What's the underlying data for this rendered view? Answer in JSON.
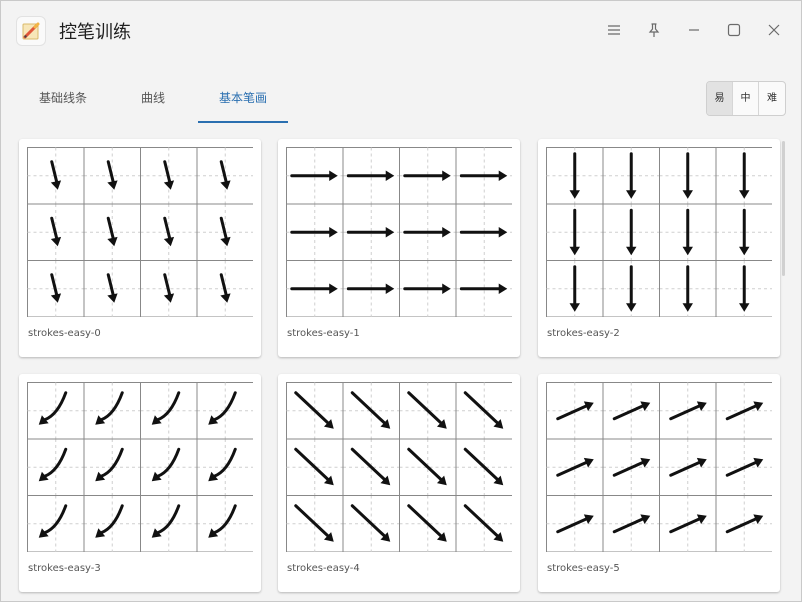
{
  "app": {
    "title": "控笔训练",
    "icon": "pencil-paper-icon"
  },
  "titlebar_buttons": [
    "menu-icon",
    "pin-icon",
    "minimize-icon",
    "maximize-icon",
    "close-icon"
  ],
  "tabs": [
    {
      "label": "基础线条",
      "active": false
    },
    {
      "label": "曲线",
      "active": false
    },
    {
      "label": "基本笔画",
      "active": true
    }
  ],
  "difficulty": [
    {
      "label": "易",
      "active": true
    },
    {
      "label": "中",
      "active": false
    },
    {
      "label": "难",
      "active": false
    }
  ],
  "cards": [
    {
      "label": "strokes-easy-0",
      "stroke": "short-down"
    },
    {
      "label": "strokes-easy-1",
      "stroke": "right"
    },
    {
      "label": "strokes-easy-2",
      "stroke": "long-down"
    },
    {
      "label": "strokes-easy-3",
      "stroke": "curve-down-left"
    },
    {
      "label": "strokes-easy-4",
      "stroke": "diagonal-down-right"
    },
    {
      "label": "strokes-easy-5",
      "stroke": "diagonal-up-right"
    }
  ],
  "colors": {
    "accent": "#2a6fb0",
    "stroke": "#111111",
    "grid_line": "#888888",
    "grid_dash": "#cfcfcf"
  }
}
